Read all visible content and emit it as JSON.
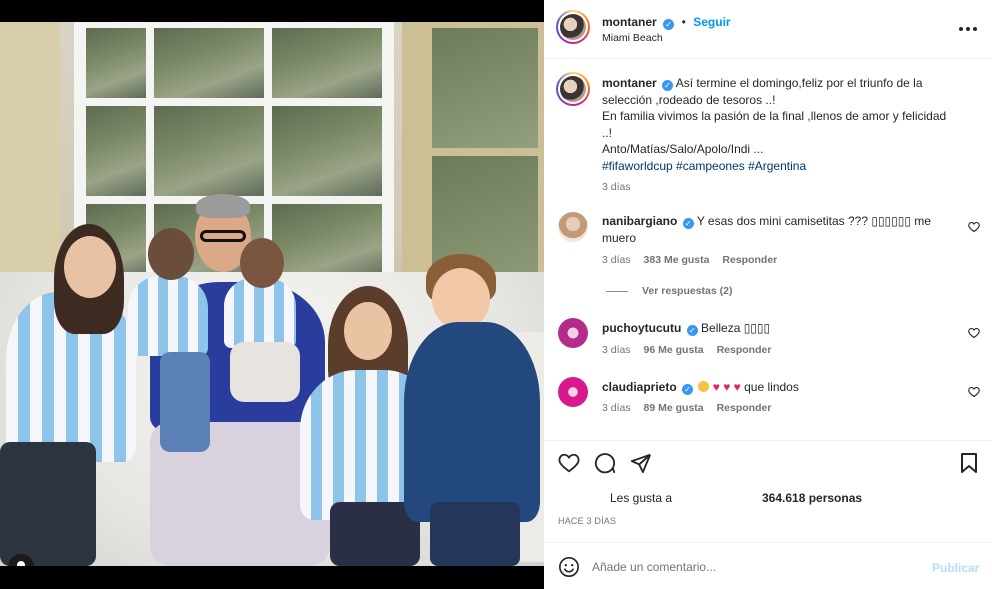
{
  "post": {
    "username": "montaner",
    "follow_label": "Seguir",
    "location": "Miami Beach",
    "more_icon": "more-horizontal-icon"
  },
  "caption": {
    "username": "montaner",
    "line1": "Así termine el domingo,feliz por el triunfo de la",
    "line2": "selección ,rodeado de tesoros ..!",
    "line3": "En familia vivimos la pasión de la final ,llenos de amor y felicidad",
    "line4": "..!",
    "line5": "Anto/Matías/Salo/Apolo/Indi ...",
    "hashtags": "#fifaworldcup #campeones #Argentina",
    "time": "3 días"
  },
  "comments": [
    {
      "username": "nanibargiano",
      "text_line1": "Y esas dos mini camisetitas ??? ▯▯▯▯▯▯ me",
      "text_line2": "muero",
      "time": "3 días",
      "likes": "383 Me gusta",
      "reply": "Responder",
      "view_replies": "Ver respuestas (2)"
    },
    {
      "username": "puchoytucutu",
      "text": "Belleza ▯▯▯▯",
      "time": "3 días",
      "likes": "96 Me gusta",
      "reply": "Responder"
    },
    {
      "username": "claudiaprieto",
      "text": "que lindos",
      "time": "3 días",
      "likes": "89 Me gusta",
      "reply": "Responder"
    }
  ],
  "actions": {
    "like_icon": "heart-icon",
    "comment_icon": "comment-icon",
    "share_icon": "share-icon",
    "save_icon": "bookmark-icon"
  },
  "likes": {
    "prefix": "Les gusta a",
    "count": "364.618 personas"
  },
  "posted": "HACE 3 DÍAS",
  "add_comment": {
    "placeholder": "Añade un comentario...",
    "publish": "Publicar"
  },
  "colors": {
    "link": "#0095f6",
    "hashtag": "#00376b",
    "verified": "#3897f0",
    "secondary": "#737373"
  }
}
